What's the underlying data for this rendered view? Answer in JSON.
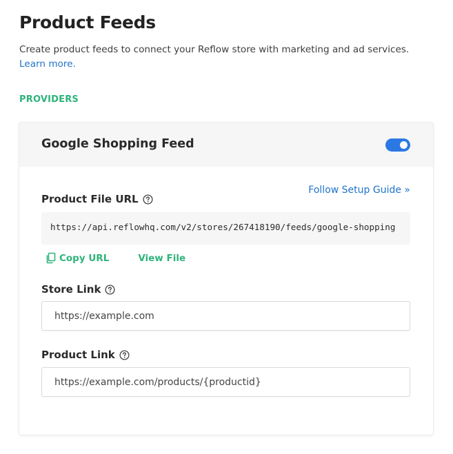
{
  "page": {
    "title": "Product Feeds",
    "description": "Create product feeds to connect your Reflow store with marketing and ad services.",
    "learn_more": "Learn more."
  },
  "section": {
    "label": "PROVIDERS"
  },
  "provider": {
    "name": "Google Shopping Feed",
    "enabled": true,
    "setup_guide_label": "Follow Setup Guide »",
    "product_file_url": {
      "label": "Product File URL",
      "value": "https://api.reflowhq.com/v2/stores/267418190/feeds/google-shopping",
      "copy_label": "Copy URL",
      "view_label": "View File"
    },
    "store_link": {
      "label": "Store Link",
      "placeholder": "https://example.com"
    },
    "product_link": {
      "label": "Product Link",
      "placeholder": "https://example.com/products/{productid}"
    }
  },
  "colors": {
    "accent_green": "#2eb37a",
    "link_blue": "#1f73c9",
    "toggle_blue": "#2b78e4"
  },
  "icons": [
    "help-circle-icon",
    "copy-icon"
  ]
}
